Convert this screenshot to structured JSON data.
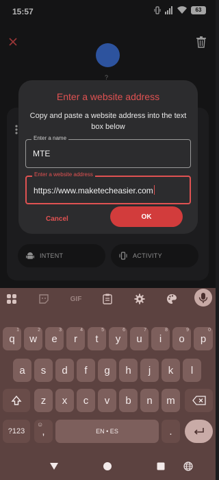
{
  "status_bar": {
    "time": "15:57",
    "battery": "63",
    "icons": [
      "vibrate-icon",
      "signal-icon",
      "wifi-icon",
      "battery-icon"
    ]
  },
  "background_app": {
    "icon_label": "?",
    "chips": [
      {
        "label": "INTENT",
        "icon": "android-icon"
      },
      {
        "label": "ACTIVITY",
        "icon": "vibration-icon"
      }
    ],
    "icons": [
      "close-icon",
      "trash-icon",
      "more-vert-icon"
    ],
    "accent_color": "#3d6fd3"
  },
  "dialog": {
    "title": "Enter a website address",
    "message": "Copy and paste a website address into the text box below",
    "name_field": {
      "label": "Enter a name",
      "value": "MTE"
    },
    "url_field": {
      "label": "Enter a website address",
      "value": "https://www.maketecheasier.com"
    },
    "cancel_label": "Cancel",
    "ok_label": "OK",
    "accent_color": "#e05252"
  },
  "keyboard": {
    "toolbar": [
      "grid-icon",
      "sticker-icon",
      "gif-icon",
      "clipboard-icon",
      "settings-icon",
      "palette-icon",
      "mic-icon"
    ],
    "gif_label": "GIF",
    "row1": [
      {
        "key": "q",
        "sup": "1"
      },
      {
        "key": "w",
        "sup": "2"
      },
      {
        "key": "e",
        "sup": "3"
      },
      {
        "key": "r",
        "sup": "4"
      },
      {
        "key": "t",
        "sup": "5"
      },
      {
        "key": "y",
        "sup": "6"
      },
      {
        "key": "u",
        "sup": "7"
      },
      {
        "key": "i",
        "sup": "8"
      },
      {
        "key": "o",
        "sup": "9"
      },
      {
        "key": "p",
        "sup": "0"
      }
    ],
    "row2": [
      "a",
      "s",
      "d",
      "f",
      "g",
      "h",
      "j",
      "k",
      "l"
    ],
    "row3": [
      "z",
      "x",
      "c",
      "v",
      "b",
      "n",
      "m"
    ],
    "symbols_label": "?123",
    "comma_label": ",",
    "emoji_label": "☺",
    "space_label": "EN • ES",
    "period_label": ".",
    "shift_icon": "shift-icon",
    "backspace_icon": "backspace-icon",
    "enter_icon": "enter-icon"
  },
  "nav_bar": {
    "icons": [
      "back-icon",
      "home-icon",
      "recents-icon",
      "globe-icon"
    ]
  }
}
